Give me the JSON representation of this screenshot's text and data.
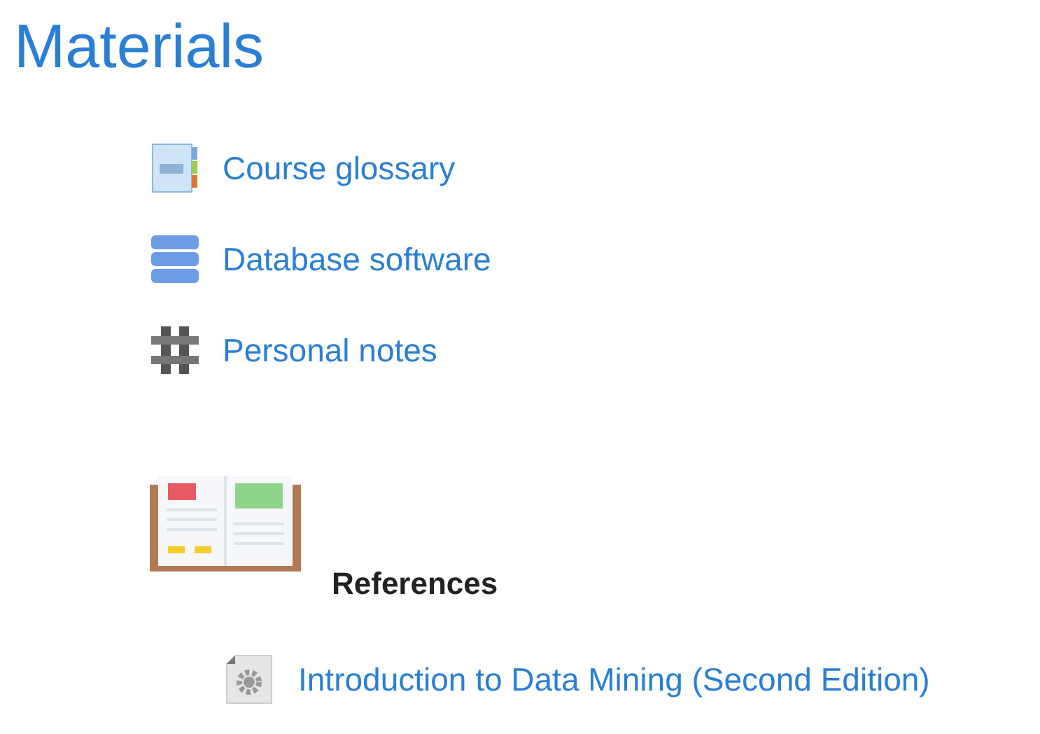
{
  "section_title": "Materials",
  "activities": [
    {
      "kind": "glossary",
      "label": "Course glossary"
    },
    {
      "kind": "database",
      "label": "Database software"
    },
    {
      "kind": "notes",
      "label": "Personal notes"
    }
  ],
  "subsection": {
    "title": "References"
  },
  "resources": [
    {
      "kind": "file",
      "label": "Introduction to Data Mining (Second Edition)"
    }
  ]
}
